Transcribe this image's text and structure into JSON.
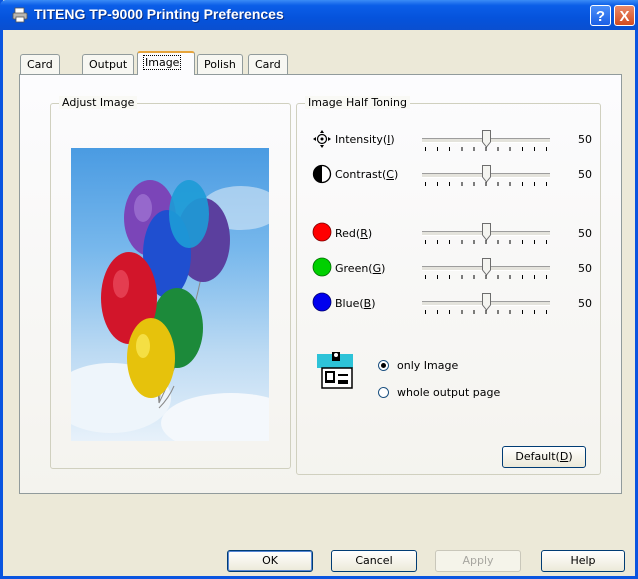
{
  "window": {
    "title": "TITENG TP-9000 Printing Preferences",
    "help_glyph": "?",
    "close_glyph": "X"
  },
  "tabs": [
    {
      "label": "Card",
      "active": false
    },
    {
      "label": "Output",
      "active": false
    },
    {
      "label": "Image",
      "active": true
    },
    {
      "label": "Polish",
      "active": false
    },
    {
      "label": "Card",
      "active": false
    }
  ],
  "adjust_image": {
    "title": "Adjust Image"
  },
  "half_toning": {
    "title": "Image Half Toning",
    "rows": [
      {
        "label_pre": "Intensity(",
        "key": "I",
        "label_post": ")",
        "value": "50",
        "level": 50
      },
      {
        "label_pre": "Contrast(",
        "key": "C",
        "label_post": ")",
        "value": "50",
        "level": 50
      },
      {
        "label_pre": "Red(",
        "key": "R",
        "label_post": ")",
        "value": "50",
        "level": 50
      },
      {
        "label_pre": "Green(",
        "key": "G",
        "label_post": ")",
        "value": "50",
        "level": 50
      },
      {
        "label_pre": "Blue(",
        "key": "B",
        "label_post": ")",
        "value": "50",
        "level": 50
      }
    ],
    "scope_options": [
      {
        "label": "only Image",
        "checked": true
      },
      {
        "label": "whole output page",
        "checked": false
      }
    ]
  },
  "default_button": {
    "label_pre": "Default(",
    "key": "D",
    "label_post": ")"
  },
  "footer": {
    "ok": "OK",
    "cancel": "Cancel",
    "apply": "Apply",
    "help": "Help"
  },
  "colors": {
    "title_bar": "#0553dc",
    "red": "#ff0000",
    "green": "#00d000",
    "blue": "#0000ee"
  }
}
